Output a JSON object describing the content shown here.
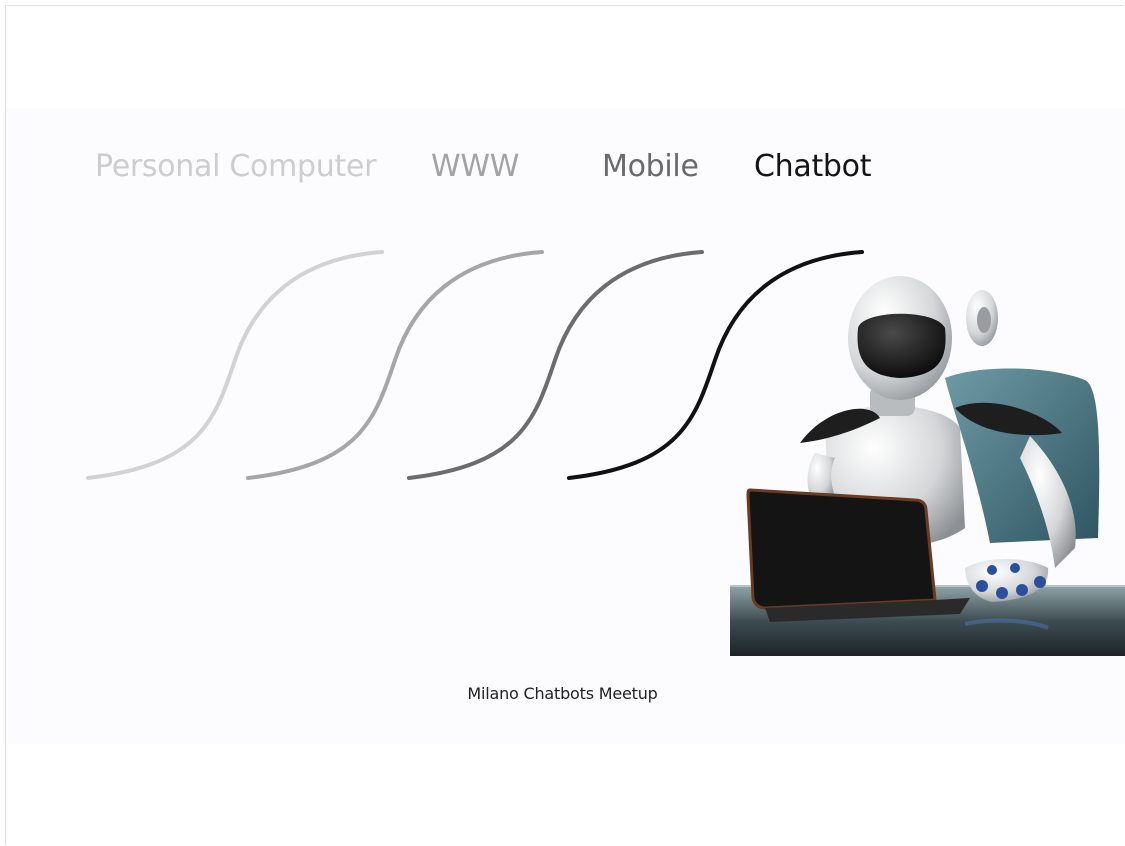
{
  "slide": {
    "eras": [
      {
        "label": "Personal Computer",
        "color": "#cdcdcd"
      },
      {
        "label": "WWW",
        "color": "#a3a3a3"
      },
      {
        "label": "Mobile",
        "color": "#6a6a6a"
      },
      {
        "label": "Chatbot",
        "color": "#141414"
      }
    ],
    "footer": "Milano Chatbots Meetup",
    "image": {
      "icon": "robot-at-laptop-illustration"
    }
  }
}
